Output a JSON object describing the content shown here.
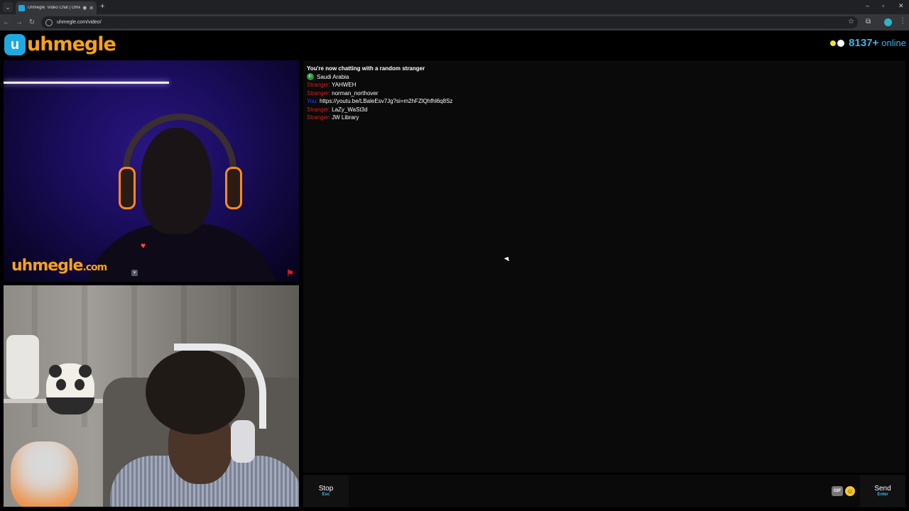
{
  "browser": {
    "tab_title": "Uhmegle: Video Chat | Omegle",
    "url": "uhmegle.com/video/",
    "new_tab": "+",
    "min": "–",
    "max": "▫",
    "close": "✕",
    "tab_close": "✕"
  },
  "header": {
    "logo_mark": "u",
    "logo_text": "uhmegle",
    "online_count": "8137+",
    "online_label": "online"
  },
  "stranger_video": {
    "watermark": "uhmegle",
    "watermark_suffix": ".com"
  },
  "chat": {
    "status": "You're now chatting with a random stranger",
    "country": "Saudi Arabia",
    "messages": [
      {
        "who": "Stranger:",
        "text": "YAHWEH"
      },
      {
        "who": "Stranger:",
        "text": "norman_northover"
      },
      {
        "who": "You:",
        "text": "https://youtu.be/LBaleEsv7Jg?si=m2hFZlQhfhl6q8Sz"
      },
      {
        "who": "Stranger:",
        "text": "LaZy_WaSt3d"
      },
      {
        "who": "Stranger:",
        "text": "JW Library"
      }
    ]
  },
  "controls": {
    "stop_label": "Stop",
    "stop_key": "Esc",
    "send_label": "Send",
    "send_key": "Enter",
    "gif_label": "GIF",
    "message_placeholder": ""
  },
  "colors": {
    "brand_orange": "#f7a21b",
    "brand_blue": "#3fb5e8",
    "stranger_red": "#e01b1b",
    "you_blue": "#2244ff"
  }
}
